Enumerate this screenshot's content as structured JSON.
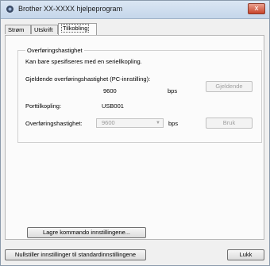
{
  "window": {
    "title": "Brother XX-XXXX hjelpeprogram",
    "close_glyph": "x"
  },
  "tabs": [
    {
      "label": "Strøm",
      "active": false
    },
    {
      "label": "Utskrift",
      "active": false
    },
    {
      "label": "Tilkobling",
      "active": true
    }
  ],
  "group": {
    "legend": "Overføringshastighet",
    "note": "Kan bare spesifiseres med en seriellkopling.",
    "current_label": "Gjeldende overføringshastighet (PC-innstilling):",
    "current_value": "9600",
    "current_unit": "bps",
    "current_button": "Gjeldende",
    "port_label": "Porttilkopling:",
    "port_value": "USB001",
    "rate_label": "Overføringshastighet:",
    "rate_selected": "9600",
    "rate_unit": "bps",
    "apply_button": "Bruk"
  },
  "buttons": {
    "save_commands": "Lagre kommando innstillingene...",
    "reset_defaults": "Nullstiller innstillinger til standardinnstillingene",
    "close": "Lukk"
  }
}
